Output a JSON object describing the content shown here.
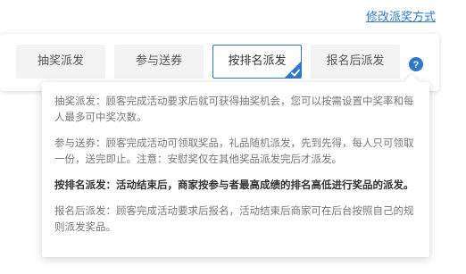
{
  "header": {
    "modify_link": "修改派奖方式"
  },
  "options": [
    {
      "label": "抽奖派发",
      "selected": false
    },
    {
      "label": "参与送券",
      "selected": false
    },
    {
      "label": "按排名派发",
      "selected": true
    },
    {
      "label": "报名后派发",
      "selected": false
    }
  ],
  "help_icon": {
    "icon": "question-circle-icon",
    "glyph": "?"
  },
  "tooltip": {
    "paragraphs": [
      "抽奖派发：顾客完成活动要求后就可获得抽奖机会，您可以按需设置中奖率和每人最多可中奖次数。",
      "参与送券：顾客完成活动可领取奖品，礼品随机派发，先到先得，每人只可领取一份，送完即止。注意：安慰奖仅在其他奖品派发完后才派发。",
      "按排名派发：活动结束后，商家按参与者最高成绩的排名高低进行奖品的派发。",
      "报名后派发：顾客完成活动要求后报名，活动结束后商家可在后台按照自己的规则派发奖品。"
    ]
  },
  "colors": {
    "accent": "#2f78c8",
    "option_bg": "#f3f3f3",
    "text_muted": "#777777",
    "text_strong": "#333333"
  }
}
